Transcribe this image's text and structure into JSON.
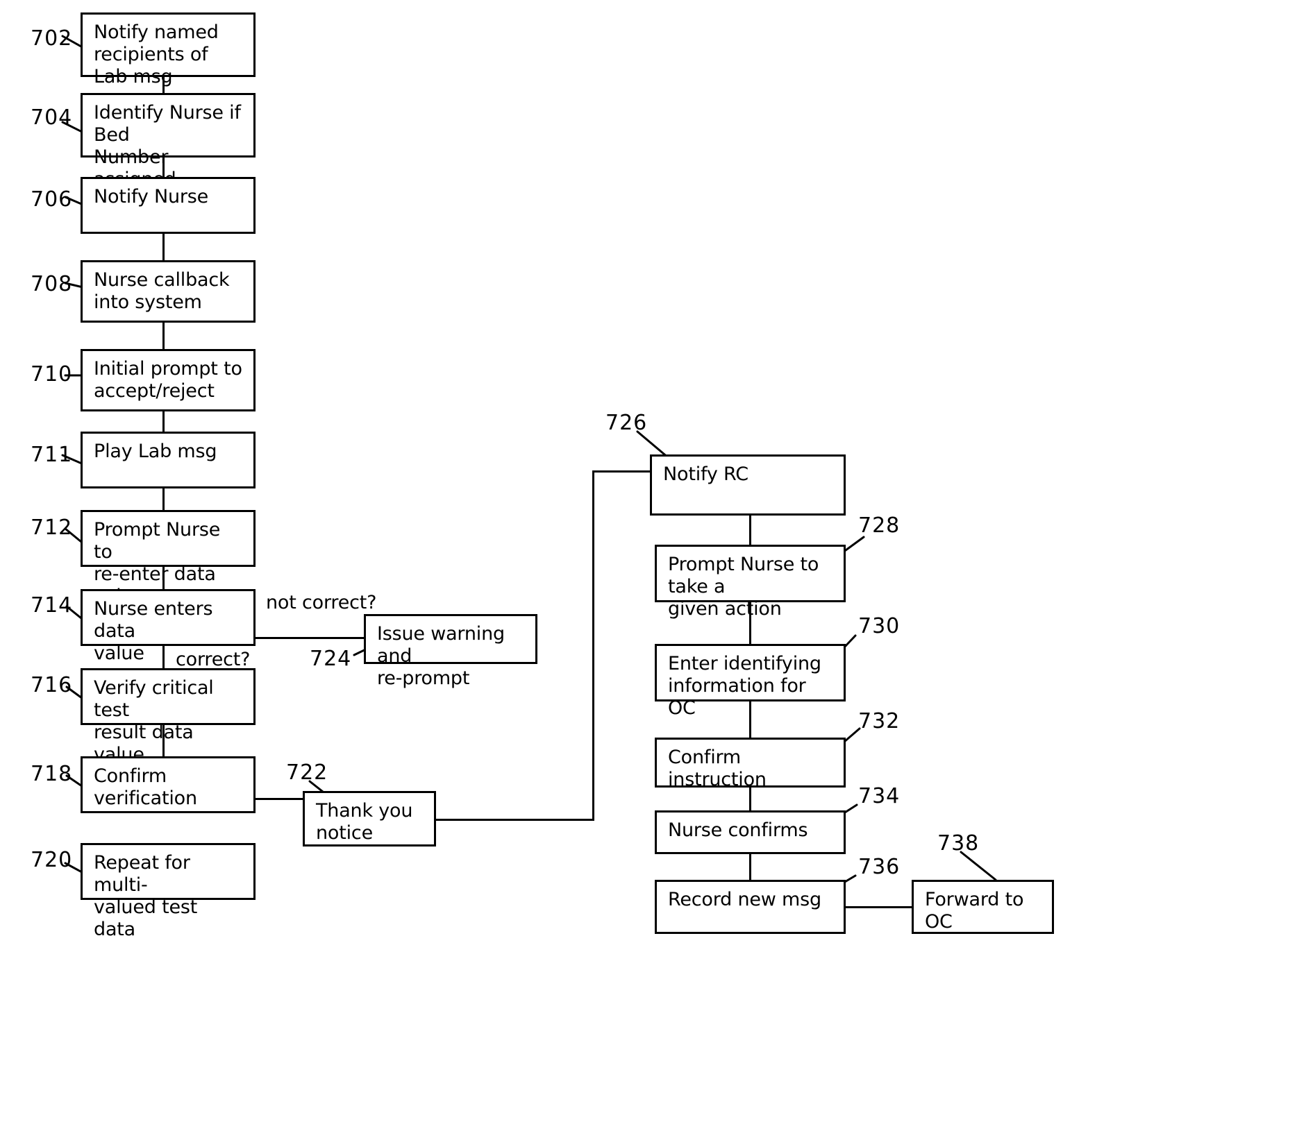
{
  "figure": {
    "type": "patent-flowchart",
    "title": "",
    "background": "#ffffff",
    "stroke": "#000000"
  },
  "nodes": [
    {
      "ref": "702",
      "text": "Notify named\nrecipients of Lab msg"
    },
    {
      "ref": "704",
      "text": "Identify Nurse if Bed\nNumber assigned"
    },
    {
      "ref": "706",
      "text": "Notify Nurse"
    },
    {
      "ref": "708",
      "text": "Nurse callback\ninto system"
    },
    {
      "ref": "710",
      "text": "Initial prompt to\naccept/reject"
    },
    {
      "ref": "711",
      "text": "Play Lab msg"
    },
    {
      "ref": "712",
      "text": "Prompt Nurse to\nre-enter data value"
    },
    {
      "ref": "714",
      "text": "Nurse enters data\nvalue"
    },
    {
      "ref": "716",
      "text": "Verify critical test\nresult data value"
    },
    {
      "ref": "718",
      "text": "Confirm\nverification"
    },
    {
      "ref": "720",
      "text": "Repeat for multi-\nvalued test data"
    },
    {
      "ref": "722",
      "text": "Thank you\nnotice"
    },
    {
      "ref": "724",
      "text": "Issue warning and\nre-prompt"
    },
    {
      "ref": "726",
      "text": "Notify RC"
    },
    {
      "ref": "728",
      "text": "Prompt Nurse to take a\ngiven action"
    },
    {
      "ref": "730",
      "text": "Enter identifying\ninformation for OC"
    },
    {
      "ref": "732",
      "text": "Confirm instruction"
    },
    {
      "ref": "734",
      "text": "Nurse confirms"
    },
    {
      "ref": "736",
      "text": "Record new msg"
    },
    {
      "ref": "738",
      "text": "Forward to\nOC"
    }
  ],
  "edge_labels": [
    {
      "id": "not-correct",
      "text": "not correct?"
    },
    {
      "id": "correct",
      "text": "correct?"
    }
  ],
  "ref_numbers": [
    "702",
    "704",
    "706",
    "708",
    "710",
    "711",
    "712",
    "714",
    "716",
    "718",
    "720",
    "722",
    "724",
    "726",
    "728",
    "730",
    "732",
    "734",
    "736",
    "738"
  ]
}
